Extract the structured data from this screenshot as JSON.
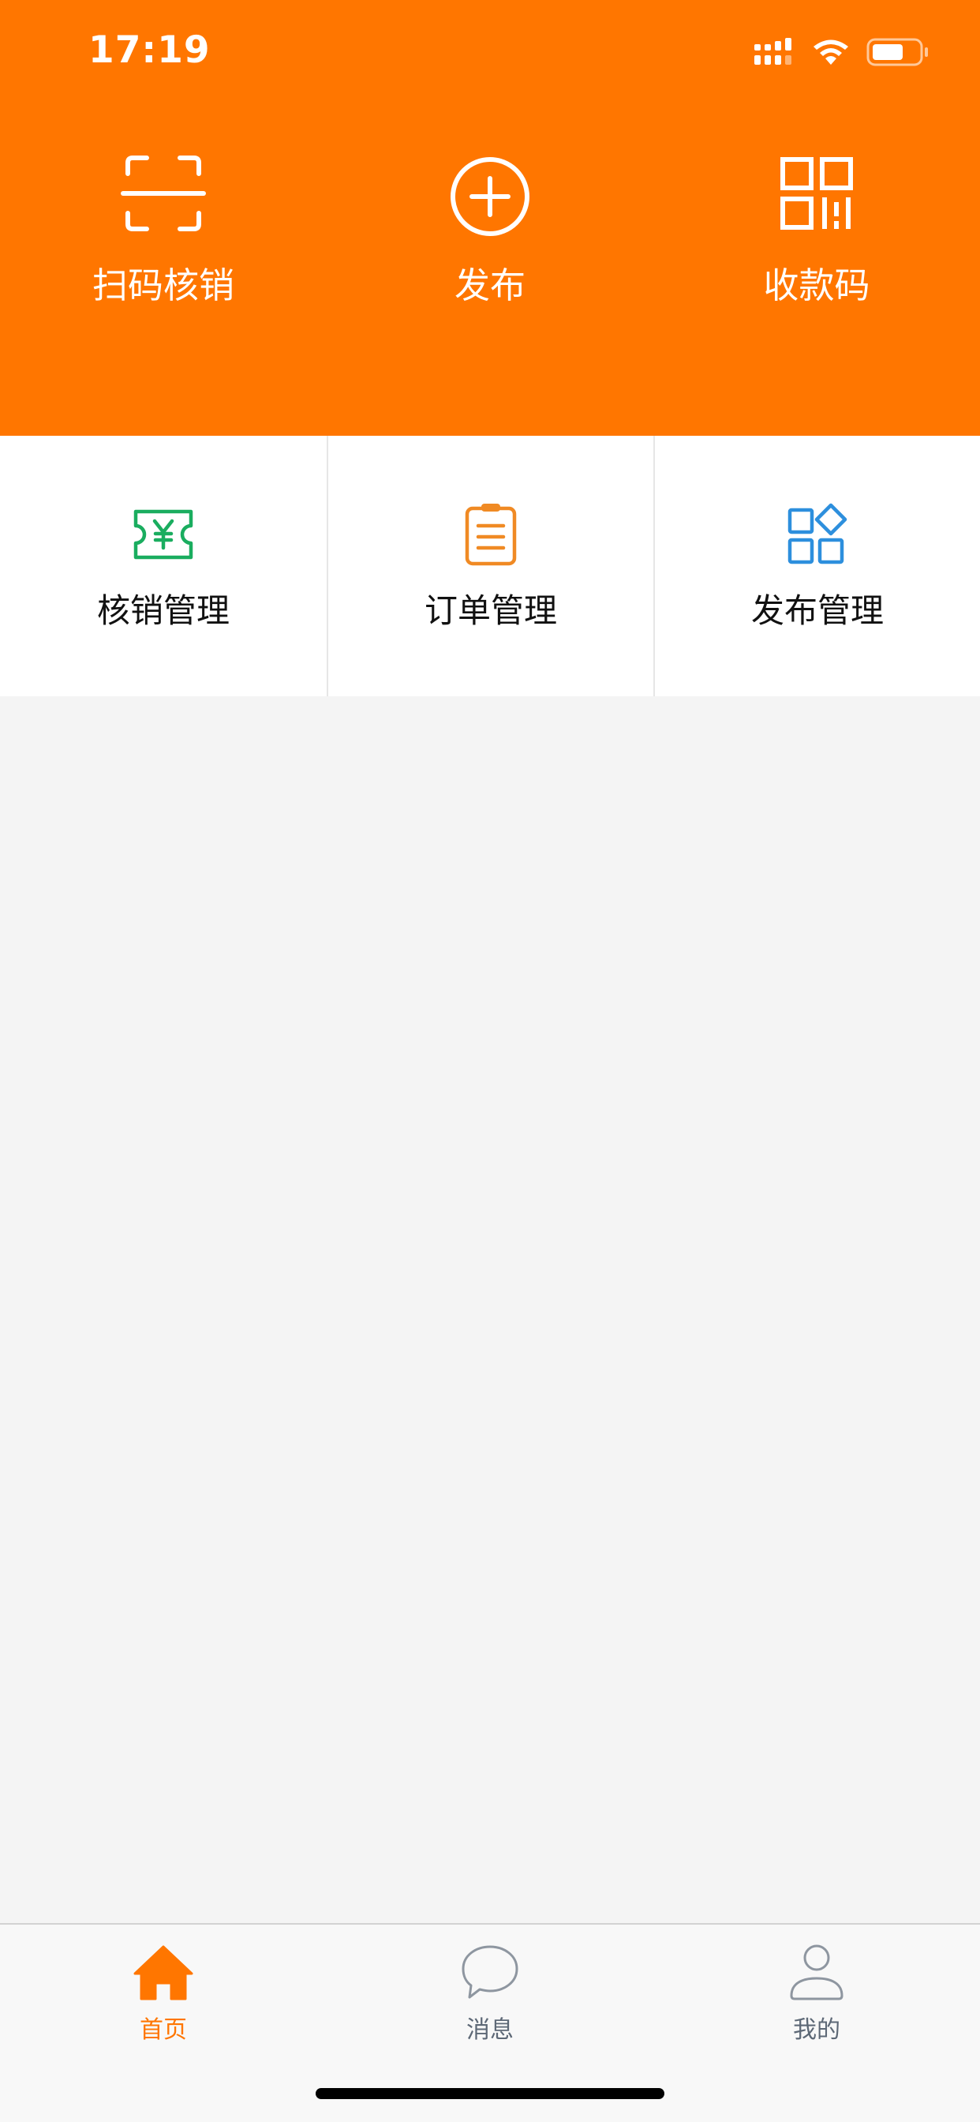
{
  "status_bar": {
    "time": "17:19"
  },
  "header": {
    "background_color": "#ff7600",
    "actions": [
      {
        "label": "扫码核销",
        "icon": "scan-icon"
      },
      {
        "label": "发布",
        "icon": "plus-circle-icon"
      },
      {
        "label": "收款码",
        "icon": "qr-code-icon"
      }
    ]
  },
  "management": {
    "items": [
      {
        "label": "核销管理",
        "icon": "ticket-yen-icon",
        "color": "#1aad5f"
      },
      {
        "label": "订单管理",
        "icon": "clipboard-icon",
        "color": "#f08a24"
      },
      {
        "label": "发布管理",
        "icon": "apps-icon",
        "color": "#2d8fdd"
      }
    ]
  },
  "tab_bar": {
    "tabs": [
      {
        "label": "首页",
        "icon": "home-icon",
        "active": true
      },
      {
        "label": "消息",
        "icon": "chat-bubble-icon",
        "active": false
      },
      {
        "label": "我的",
        "icon": "user-icon",
        "active": false
      }
    ],
    "active_color": "#ff7600",
    "inactive_color": "#5d6876"
  }
}
